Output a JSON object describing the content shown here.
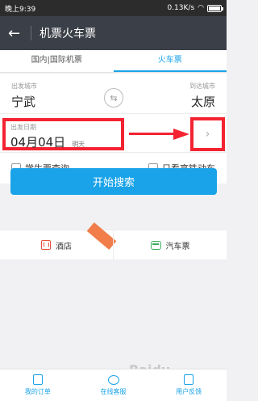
{
  "status_bar": {
    "time": "晚上9:39",
    "network": "0.13K/s",
    "battery_level": 0.85
  },
  "header": {
    "back_icon": "back-arrow-icon",
    "title": "机票火车票"
  },
  "tabs": [
    {
      "label": "国内|国际机票",
      "active": false
    },
    {
      "label": "火车票",
      "active": true
    }
  ],
  "trip": {
    "departure_label": "出发城市",
    "departure_city": "宁武",
    "arrival_label": "到达城市",
    "arrival_city": "太原",
    "swap_icon": "swap-icon",
    "date_label": "出发日期",
    "date": "04月04日",
    "date_day": "明天"
  },
  "options": {
    "student": "学生票查询",
    "high_speed": "只看高铁动车"
  },
  "search_button": "开始搜索",
  "quick_links": [
    {
      "label": "酒店",
      "icon": "hotel-icon",
      "badge": ""
    },
    {
      "label": "汽车票",
      "icon": "bus-icon"
    }
  ],
  "bottom_nav": [
    {
      "label": "我的订单",
      "icon": "orders-icon"
    },
    {
      "label": "在线客服",
      "icon": "chat-icon"
    },
    {
      "label": "用户反馈",
      "icon": "feedback-icon"
    }
  ],
  "watermark": "Baidu",
  "colors": {
    "accent": "#1aa3e8",
    "highlight": "#f32331",
    "header": "#3b3f47"
  }
}
